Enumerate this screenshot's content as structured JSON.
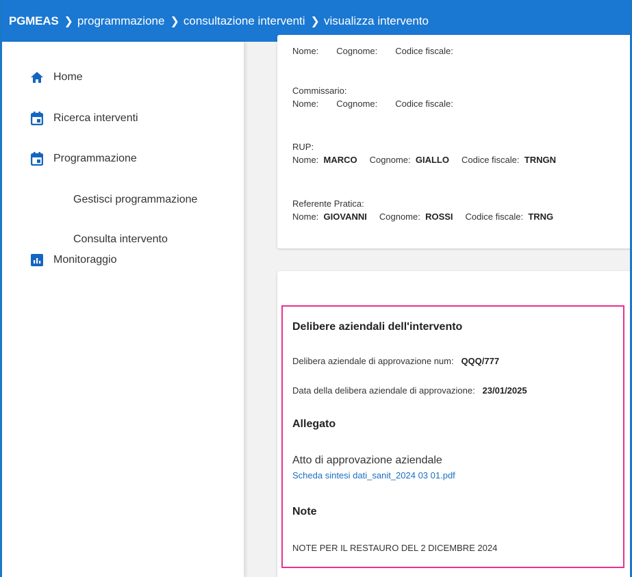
{
  "breadcrumb": {
    "brand": "PGMEAS",
    "items": [
      "programmazione",
      "consultazione interventi",
      "visualizza intervento"
    ]
  },
  "sidebar": {
    "items": [
      {
        "label": "Home",
        "icon": "home-icon"
      },
      {
        "label": "Ricerca interventi",
        "icon": "calendar-icon"
      },
      {
        "label": "Programmazione",
        "icon": "calendar-icon"
      },
      {
        "label": "Gestisci programmazione"
      },
      {
        "label": "Consulta intervento"
      },
      {
        "label": "Monitoraggio",
        "icon": "bar-chart-icon"
      }
    ]
  },
  "people": {
    "labels": {
      "nome": "Nome:",
      "cognome": "Cognome:",
      "cf": "Codice fiscale:"
    },
    "commissario": {
      "label": "Commissario:"
    },
    "rup": {
      "label": "RUP:",
      "nome": "MARCO",
      "cognome": "GIALLO",
      "cf": "TRNGN"
    },
    "referente": {
      "label": "Referente Pratica:",
      "nome": "GIOVANNI",
      "cognome": "ROSSI",
      "cf": "TRNG"
    }
  },
  "delibere": {
    "title": "Delibere aziendali dell'intervento",
    "num_label": "Delibera aziendale di approvazione num:",
    "num_value": "QQQ/777",
    "data_label": "Data della delibera aziendale di approvazione:",
    "data_value": "23/01/2025",
    "allegato_title": "Allegato",
    "allegato_type": "Atto di approvazione aziendale",
    "allegato_file": "Scheda sintesi dati_sanit_2024 03 01.pdf",
    "note_title": "Note",
    "note_text": "NOTE PER IL RESTAURO DEL 2 DICEMBRE 2024"
  },
  "colors": {
    "topbar": "#1a78d2",
    "highlight": "#e8318e",
    "link": "#1a6fbf"
  }
}
